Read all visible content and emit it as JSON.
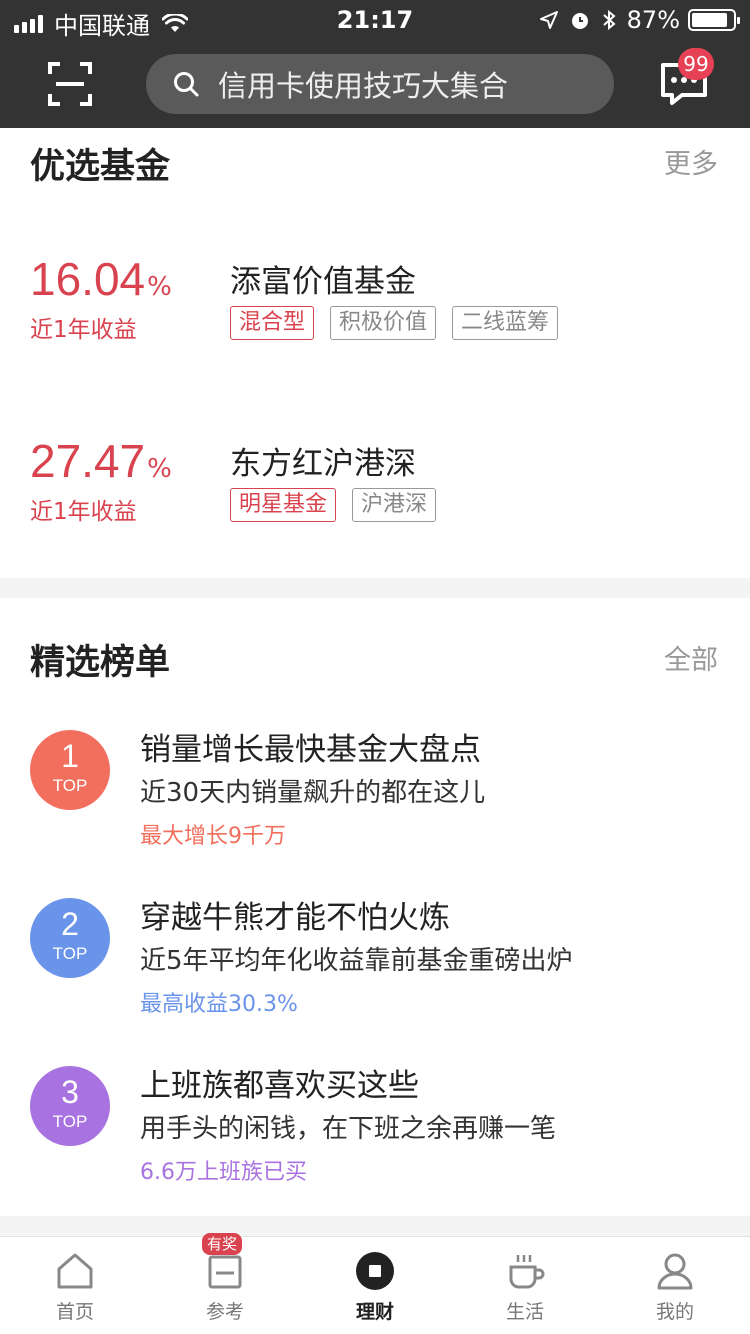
{
  "status_bar": {
    "carrier": "中国联通",
    "time": "21:17",
    "battery_text": "87%",
    "battery_level": 0.87
  },
  "header": {
    "search_placeholder": "信用卡使用技巧大集合",
    "message_badge": "99",
    "icons": [
      "scan-icon",
      "search-icon",
      "message-icon"
    ]
  },
  "funds_section": {
    "title": "优选基金",
    "more": "更多",
    "items": [
      {
        "rate": "16.04",
        "unit": "%",
        "rate_label": "近1年收益",
        "name": "添富价值基金",
        "tags": [
          {
            "text": "混合型",
            "highlight": true
          },
          {
            "text": "积极价值",
            "highlight": false
          },
          {
            "text": "二线蓝筹",
            "highlight": false
          }
        ]
      },
      {
        "rate": "27.47",
        "unit": "%",
        "rate_label": "近1年收益",
        "name": "东方红沪港深",
        "tags": [
          {
            "text": "明星基金",
            "highlight": true
          },
          {
            "text": "沪港深",
            "highlight": false
          }
        ]
      }
    ]
  },
  "ranking_section": {
    "title": "精选榜单",
    "more": "全部",
    "items": [
      {
        "number": "1",
        "badge_label": "TOP",
        "color": "#f26f5e",
        "title": "销量增长最快基金大盘点",
        "desc": "近30天内销量飙升的都在这儿",
        "note": "最大增长9千万"
      },
      {
        "number": "2",
        "badge_label": "TOP",
        "color": "#6a93ea",
        "title": "穿越牛熊才能不怕火炼",
        "desc": "近5年平均年化收益靠前基金重磅出炉",
        "note": "最高收益30.3%"
      },
      {
        "number": "3",
        "badge_label": "TOP",
        "color": "#a873e0",
        "title": "上班族都喜欢买这些",
        "desc": "用手头的闲钱，在下班之余再赚一笔",
        "note": "6.6万上班族已买"
      }
    ]
  },
  "tabbar": {
    "tabs": [
      {
        "label": "首页",
        "icon": "home-icon"
      },
      {
        "label": "参考",
        "icon": "calendar-icon",
        "badge": "有奖"
      },
      {
        "label": "理财",
        "icon": "finance-icon",
        "active": true
      },
      {
        "label": "生活",
        "icon": "cup-icon"
      },
      {
        "label": "我的",
        "icon": "profile-icon"
      }
    ]
  },
  "colors": {
    "header_bg": "#333333",
    "accent_red": "#d9434f",
    "badge_red": "#e64155"
  }
}
